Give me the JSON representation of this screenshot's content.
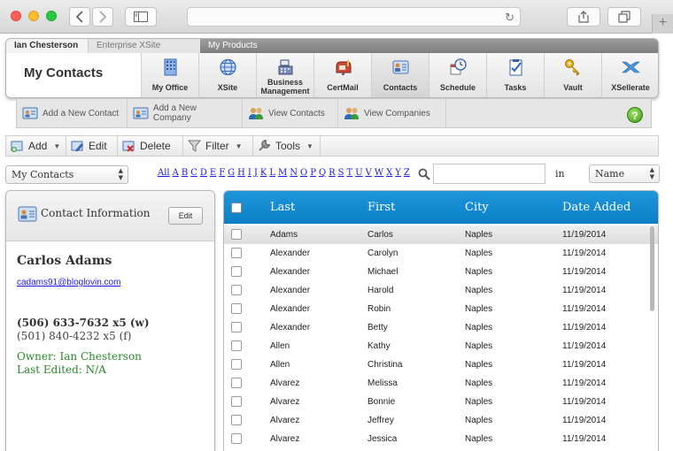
{
  "app": {
    "top_tabs": [
      "Ian Chesterson",
      "Enterprise XSite",
      "My Products"
    ],
    "title": "My Contacts",
    "modules": [
      {
        "label": "My Office",
        "icon": "building-icon"
      },
      {
        "label": "XSite",
        "icon": "globe-icon"
      },
      {
        "label": "Business Management",
        "icon": "cash-register-icon"
      },
      {
        "label": "CertMail",
        "icon": "mailbox-icon"
      },
      {
        "label": "Contacts",
        "icon": "contacts-icon"
      },
      {
        "label": "Schedule",
        "icon": "clock-calendar-icon"
      },
      {
        "label": "Tasks",
        "icon": "checklist-icon"
      },
      {
        "label": "Vault",
        "icon": "key-icon"
      },
      {
        "label": "XSellerate",
        "icon": "xsellerate-logo-icon"
      }
    ],
    "active_module": "Contacts"
  },
  "actions": {
    "add_contact": "Add a New Contact",
    "add_company": "Add a New Company",
    "view_contacts": "View Contacts",
    "view_companies": "View Companies"
  },
  "toolbar": {
    "add": "Add",
    "edit": "Edit",
    "delete": "Delete",
    "filter": "Filter",
    "tools": "Tools"
  },
  "filters": {
    "list_select": "My Contacts",
    "alphabet": [
      "All",
      "A",
      "B",
      "C",
      "D",
      "E",
      "F",
      "G",
      "H",
      "I",
      "J",
      "K",
      "L",
      "M",
      "N",
      "O",
      "P",
      "Q",
      "R",
      "S",
      "T",
      "U",
      "V",
      "W",
      "X",
      "Y",
      "Z"
    ],
    "search_value": "",
    "in_label": "in",
    "field_select": "Name"
  },
  "contact_panel": {
    "title": "Contact Information",
    "edit_label": "Edit",
    "name": "Carlos Adams",
    "email": "cadams91@bloglovin.com",
    "phone_work": "(506) 633-7632 x5 (w)",
    "phone_fax": "(501) 840-4232 x5 (f)",
    "owner": "Owner: Ian Chesterson",
    "last_edited": "Last Edited: N/A"
  },
  "grid": {
    "columns": [
      "Last",
      "First",
      "City",
      "Date Added"
    ],
    "rows": [
      {
        "last": "Adams",
        "first": "Carlos",
        "city": "Naples",
        "date": "11/19/2014"
      },
      {
        "last": "Alexander",
        "first": "Carolyn",
        "city": "Naples",
        "date": "11/19/2014"
      },
      {
        "last": "Alexander",
        "first": "Michael",
        "city": "Naples",
        "date": "11/19/2014"
      },
      {
        "last": "Alexander",
        "first": "Harold",
        "city": "Naples",
        "date": "11/19/2014"
      },
      {
        "last": "Alexander",
        "first": "Robin",
        "city": "Naples",
        "date": "11/19/2014"
      },
      {
        "last": "Alexander",
        "first": "Betty",
        "city": "Naples",
        "date": "11/19/2014"
      },
      {
        "last": "Allen",
        "first": "Kathy",
        "city": "Naples",
        "date": "11/19/2014"
      },
      {
        "last": "Allen",
        "first": "Christina",
        "city": "Naples",
        "date": "11/19/2014"
      },
      {
        "last": "Alvarez",
        "first": "Melissa",
        "city": "Naples",
        "date": "11/19/2014"
      },
      {
        "last": "Alvarez",
        "first": "Bonnie",
        "city": "Naples",
        "date": "11/19/2014"
      },
      {
        "last": "Alvarez",
        "first": "Jeffrey",
        "city": "Naples",
        "date": "11/19/2014"
      },
      {
        "last": "Alvarez",
        "first": "Jessica",
        "city": "Naples",
        "date": "11/19/2014"
      }
    ],
    "selected_row": 0
  },
  "colors": {
    "grid_header": "#0f86cd",
    "link": "#1a1ae0",
    "owner_text": "#2a8a2a",
    "help": "#4aa81c"
  }
}
